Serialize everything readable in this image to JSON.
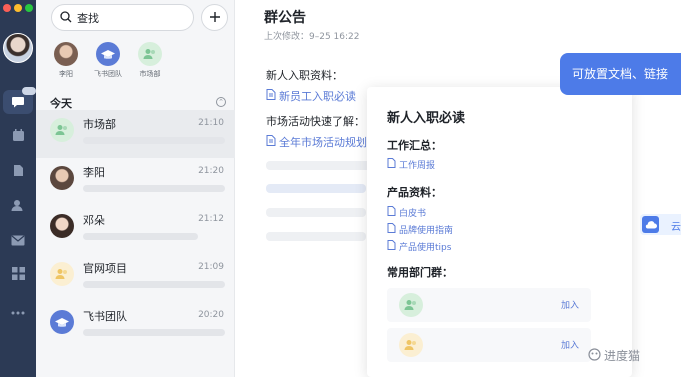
{
  "search": {
    "label": "查找"
  },
  "pinned": [
    {
      "label": "李阳",
      "color": "#7a5f52"
    },
    {
      "label": "飞书团队",
      "color": "#5b7bd6"
    },
    {
      "label": "市场部",
      "color": "#bfe3c9"
    }
  ],
  "section_today": "今天",
  "chats": [
    {
      "name": "市场部",
      "time": "21:10",
      "avatar_color": "#bfe3c9"
    },
    {
      "name": "李阳",
      "time": "21:20",
      "avatar_color": "#7a5f52"
    },
    {
      "name": "邓朵",
      "time": "21:12",
      "avatar_color": "#5a463f"
    },
    {
      "name": "官网项目",
      "time": "21:09",
      "avatar_color": "#f6dfa8"
    },
    {
      "name": "飞书团队",
      "time": "20:20",
      "avatar_color": "#5b7bd6"
    }
  ],
  "announcement": {
    "title": "群公告",
    "modified": "上次修改：9–25 16:22",
    "section1": "新人入职资料：",
    "link1": "新员工入职必读",
    "section2": "市场活动快速了解：",
    "link2": "全年市场活动规划"
  },
  "card": {
    "title": "新人入职必读",
    "sec_work": "工作汇总：",
    "work_links": [
      "工作周报"
    ],
    "sec_product": "产品资料：",
    "product_links": [
      "白皮书",
      "品牌使用指南",
      "产品使用tips"
    ],
    "sec_groups": "常用部门群：",
    "join_label": "加入"
  },
  "tooltip": "可放置文档、链接",
  "cloud_label": "云",
  "watermark": "进度猫",
  "colors": {
    "accent": "#4d7be8",
    "link": "#5b7bd6",
    "rail": "#2c3a55"
  }
}
